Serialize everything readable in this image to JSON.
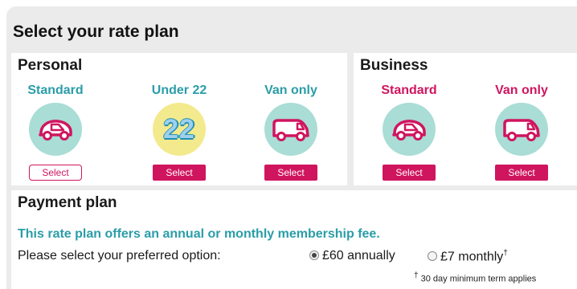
{
  "page": {
    "title": "Select your rate plan"
  },
  "personal": {
    "title": "Personal",
    "plans": [
      {
        "name": "Standard",
        "button": "Select",
        "icon": "car-icon",
        "color": "#2a9da8"
      },
      {
        "name": "Under 22",
        "button": "Select",
        "icon": "age-22-icon",
        "age_text": "22",
        "color": "#2a9da8"
      },
      {
        "name": "Van only",
        "button": "Select",
        "icon": "van-icon",
        "color": "#2a9da8"
      }
    ]
  },
  "business": {
    "title": "Business",
    "plans": [
      {
        "name": "Standard",
        "button": "Select",
        "icon": "car-icon",
        "color": "#d0155f"
      },
      {
        "name": "Van only",
        "button": "Select",
        "icon": "van-icon",
        "color": "#d0155f"
      }
    ]
  },
  "payment": {
    "title": "Payment plan",
    "description": "This rate plan offers an annual or monthly membership fee.",
    "prompt": "Please select your preferred option:",
    "options": [
      {
        "label": "£60 annually",
        "selected": true
      },
      {
        "label": "£7 monthly",
        "marker": "†",
        "selected": false
      }
    ],
    "footnote_marker": "†",
    "footnote": "30 day minimum term applies"
  },
  "colors": {
    "brand_pink": "#d0155f",
    "brand_teal": "#2a9da8",
    "circle_teal": "#a9ddd6",
    "circle_yellow": "#f3ea8e"
  }
}
